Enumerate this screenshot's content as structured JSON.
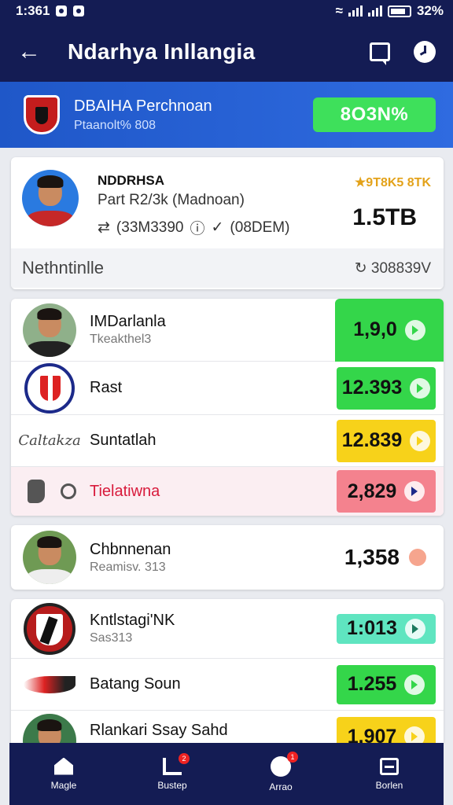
{
  "status_bar": {
    "time": "1:361",
    "battery": "32%"
  },
  "header": {
    "title": "Ndarhya Inllangia"
  },
  "team_banner": {
    "name": "DBAIHA Perchnoan",
    "subtitle": "Ptaanolt% 808",
    "button_label": "8O3N%"
  },
  "profile": {
    "name": "NDDRHSA",
    "subtitle": "Part R2/3k (Madnoan)",
    "stat_left": "(33M3390",
    "stat_right": "(08DEM)",
    "rating": "9T8K5 8TK",
    "score": "1.5TB",
    "section_label": "Nethntinlle",
    "code": "308839V"
  },
  "list1": [
    {
      "title": "IMDarlanla",
      "subtitle": "Tkeakthel3",
      "value": "1,9,0",
      "color": "green"
    },
    {
      "title": "Rast",
      "subtitle": "",
      "value": "12.393",
      "color": "green"
    },
    {
      "title": "Suntatlah",
      "subtitle": "",
      "value": "12.839",
      "color": "yellow"
    },
    {
      "title": "Tielatiwna",
      "subtitle": "",
      "value": "2,829",
      "color": "pink"
    }
  ],
  "list1_script_logo": "Caltakza",
  "single_row": {
    "title": "Chbnnenan",
    "subtitle": "Reamisv. 313",
    "value": "1,358"
  },
  "list2": [
    {
      "title": "Kntlstagi'NK",
      "subtitle": "Sas313",
      "value": "1:013",
      "color": "teal"
    },
    {
      "title": "Batang Soun",
      "subtitle": "",
      "value": "1.255",
      "color": "green"
    },
    {
      "title": "Rlankari Ssay Sahd",
      "subtitle": "",
      "value": "1.907",
      "color": "yellow"
    }
  ],
  "bottom_nav": [
    {
      "label": "Magle",
      "badge": ""
    },
    {
      "label": "Bustep",
      "badge": "2"
    },
    {
      "label": "Arrao",
      "badge": "1"
    },
    {
      "label": "Borlen",
      "badge": ""
    }
  ],
  "colors": {
    "navy": "#141c54",
    "blue": "#2f6be0",
    "green": "#34d64a",
    "yellow": "#f7d21a",
    "pink": "#f4828e",
    "teal": "#5fe5c0"
  }
}
